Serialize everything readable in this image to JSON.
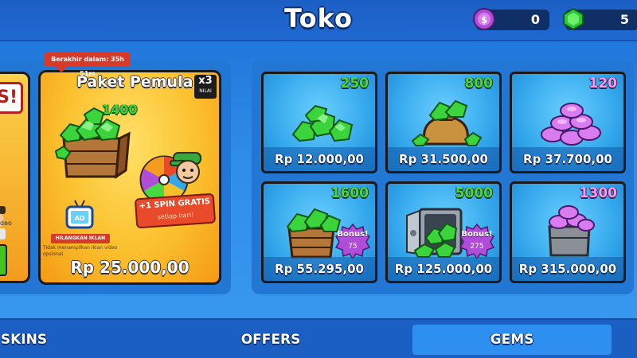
{
  "header": {
    "title": "Toko",
    "coins": {
      "value": "0",
      "icon": "coin-icon",
      "color": "#b04dd8"
    },
    "gems": {
      "value": "5",
      "icon": "gem-icon",
      "color": "#2fc83a"
    }
  },
  "edge_card": {
    "tag_text": "IS!",
    "note_text": "deo"
  },
  "starter_pack": {
    "timer": "Berakhir dalam: 35h 51m",
    "title": "Paket Pemula",
    "multiplier": "x3",
    "multiplier_sub": "NILAI",
    "gem_amount": "1400",
    "spin_line1": "+1 SPIN GRATIS",
    "spin_line2": "setiap hari!",
    "ad_label": "AD",
    "remove_ads": "HILANGKAN IKLAN",
    "ad_note": "Tidak menampilkan iklan video opsional",
    "price": "Rp 25.000,00"
  },
  "gem_offers": [
    {
      "amount": "250",
      "currency": "gem",
      "price": "Rp 12.000,00",
      "art": "gem-pile-small"
    },
    {
      "amount": "800",
      "currency": "gem",
      "price": "Rp 31.500,00",
      "art": "gem-sack"
    },
    {
      "amount": "120",
      "currency": "coin",
      "price": "Rp 37.700,00",
      "art": "coin-pile"
    },
    {
      "amount": "1600",
      "currency": "gem",
      "price": "Rp 55.295,00",
      "art": "gem-crate",
      "bonus_label": "Bonus!",
      "bonus_value": "75"
    },
    {
      "amount": "5000",
      "currency": "gem",
      "price": "Rp 125.000,00",
      "art": "gem-vault",
      "bonus_label": "Bonus!",
      "bonus_value": "275"
    },
    {
      "amount": "1300",
      "currency": "coin",
      "price": "Rp 315.000,00",
      "art": "coin-crate"
    }
  ],
  "tabs": [
    {
      "label": "SKINS",
      "active": false
    },
    {
      "label": "OFFERS",
      "active": false
    },
    {
      "label": "GEMS",
      "active": true
    }
  ]
}
